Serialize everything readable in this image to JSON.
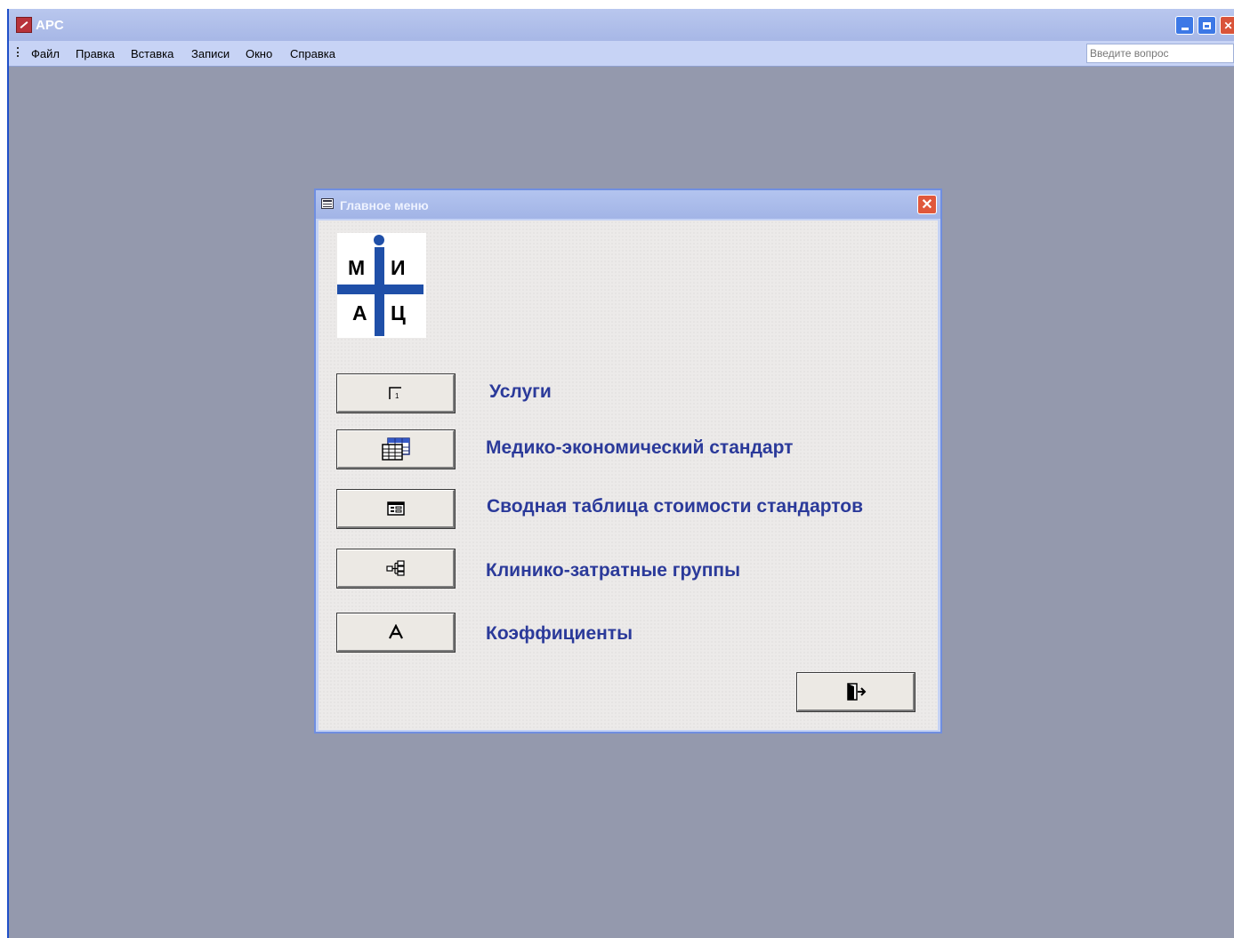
{
  "app": {
    "title": "APC"
  },
  "menubar": {
    "items": [
      "Файл",
      "Правка",
      "Вставка",
      "Записи",
      "Окно",
      "Справка"
    ],
    "ask_placeholder": "Введите вопрос"
  },
  "dialog": {
    "title": "Главное меню",
    "logo": {
      "letters": [
        "М",
        "И",
        "А",
        "Ц"
      ],
      "color": "#1f4fa8"
    },
    "items": [
      {
        "label": "Услуги",
        "icon": "report-icon"
      },
      {
        "label": "Медико-экономический стандарт",
        "icon": "datasheet-icon"
      },
      {
        "label": "Сводная таблица стоимости стандартов",
        "icon": "form-icon"
      },
      {
        "label": "Клинико-затратные группы",
        "icon": "tree-icon"
      },
      {
        "label": "Коэффициенты",
        "icon": "letter-a-icon"
      }
    ],
    "exit_icon": "exit-door-icon"
  },
  "colors": {
    "workspace": "#9499ad",
    "label_text": "#2b3a9a",
    "title_bar": "#a7b7e6",
    "close_button": "#e0583c"
  }
}
